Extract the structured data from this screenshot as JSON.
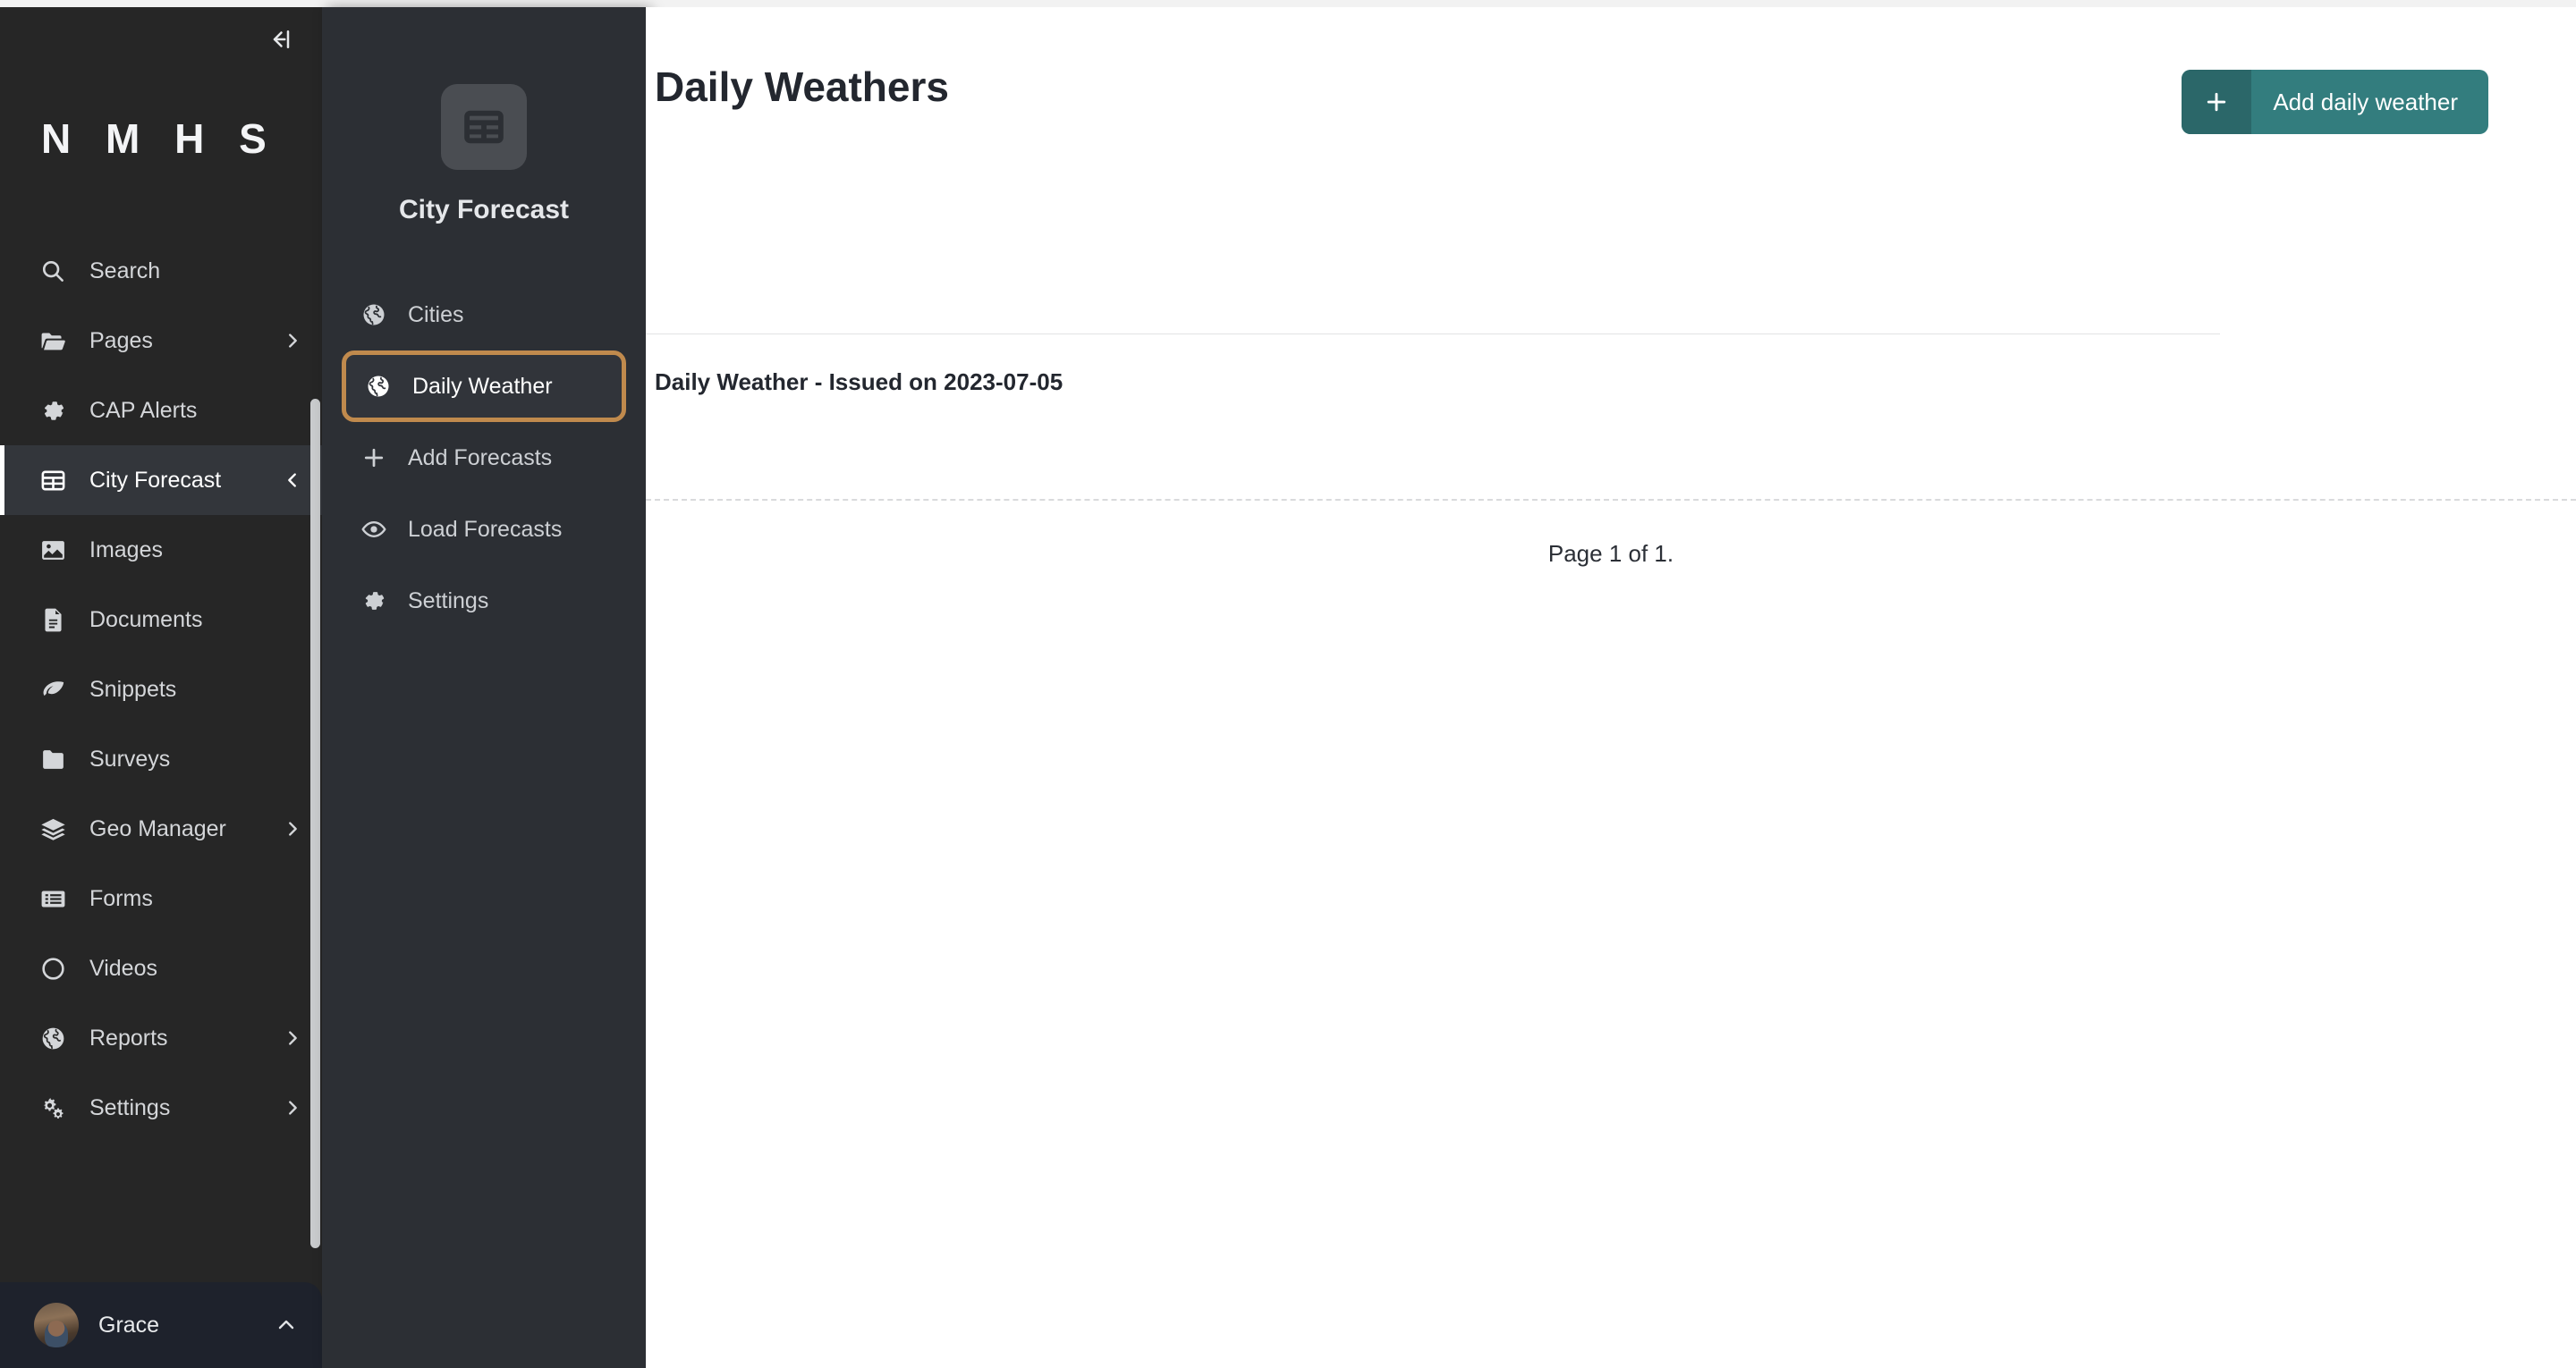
{
  "brand": {
    "name": "N M H S",
    "collapse_icon": "collapse-left-icon"
  },
  "sidebar": {
    "items": [
      {
        "label": "Search",
        "icon": "search-icon",
        "chevron": "",
        "active": false
      },
      {
        "label": "Pages",
        "icon": "folder-open-icon",
        "chevron": ">",
        "active": false
      },
      {
        "label": "CAP Alerts",
        "icon": "gear-icon",
        "chevron": "",
        "active": false
      },
      {
        "label": "City Forecast",
        "icon": "table-icon",
        "chevron": "<",
        "active": true
      },
      {
        "label": "Images",
        "icon": "image-icon",
        "chevron": "",
        "active": false
      },
      {
        "label": "Documents",
        "icon": "document-icon",
        "chevron": "",
        "active": false
      },
      {
        "label": "Snippets",
        "icon": "leaf-icon",
        "chevron": "",
        "active": false
      },
      {
        "label": "Surveys",
        "icon": "folder-icon",
        "chevron": "",
        "active": false
      },
      {
        "label": "Geo Manager",
        "icon": "layers-icon",
        "chevron": ">",
        "active": false
      },
      {
        "label": "Forms",
        "icon": "form-list-icon",
        "chevron": "",
        "active": false
      },
      {
        "label": "Videos",
        "icon": "circle-icon",
        "chevron": "",
        "active": false
      },
      {
        "label": "Reports",
        "icon": "globe-icon",
        "chevron": ">",
        "active": false
      },
      {
        "label": "Settings",
        "icon": "gears-icon",
        "chevron": ">",
        "active": false
      }
    ],
    "user": {
      "name": "Grace",
      "chevron": "^",
      "avatar": "user-avatar"
    }
  },
  "submenu": {
    "title": "City Forecast",
    "header_icon": "table-icon",
    "items": [
      {
        "label": "Cities",
        "icon": "globe-icon",
        "highlighted": false
      },
      {
        "label": "Daily Weather",
        "icon": "globe-icon",
        "highlighted": true
      },
      {
        "label": "Add Forecasts",
        "icon": "plus-icon",
        "highlighted": false
      },
      {
        "label": "Load Forecasts",
        "icon": "eye-icon",
        "highlighted": false
      },
      {
        "label": "Settings",
        "icon": "gear-icon",
        "highlighted": false
      }
    ]
  },
  "main": {
    "page_title": "Daily Weathers",
    "add_button": {
      "label": "Add daily weather",
      "icon": "plus-icon"
    },
    "rows": [
      {
        "label": "Daily Weather - Issued on 2023-07-05"
      }
    ],
    "pagination": "Page 1 of 1."
  },
  "colors": {
    "sidebar_bg": "#262626",
    "submenu_bg": "#2c2f34",
    "active_row_bg": "#33363b",
    "highlight_ring": "#c08a4d",
    "accent_button": "#337d7e",
    "accent_button_dark": "#2b6769",
    "user_strip_bg": "#1e222c",
    "text_primary": "#23272f"
  }
}
